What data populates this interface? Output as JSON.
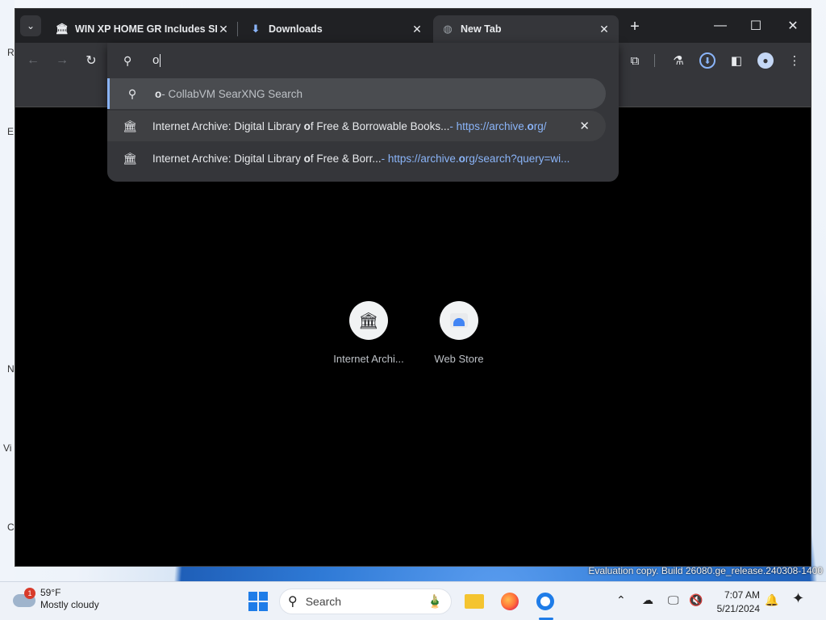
{
  "desktop": {
    "edge_letters": [
      "R",
      "E",
      "N",
      "Vi",
      "C"
    ]
  },
  "browser": {
    "tabs": [
      {
        "label": "WIN XP HOME GR Includes SP",
        "icon": "archive-icon"
      },
      {
        "label": "Downloads",
        "icon": "download-icon"
      },
      {
        "label": "New Tab",
        "icon": "globe-icon",
        "active": true
      }
    ],
    "omnibox": {
      "value": "o",
      "suggestions": [
        {
          "bold": "o",
          "text": " - CollabVM SearXNG Search",
          "icon": "search-icon"
        },
        {
          "title_pre": "Internet Archive: Digital Library ",
          "title_bold": "o",
          "title_post": "f Free & Borrowable Books...",
          "sep": " - ",
          "url_pre": "https://archive.",
          "url_bold": "o",
          "url_post": "rg/",
          "icon": "archive-icon"
        },
        {
          "title_pre": "Internet Archive: Digital Library ",
          "title_bold": "o",
          "title_post": "f Free & Borr...",
          "sep": " - ",
          "url_pre": "https://archive.",
          "url_bold": "o",
          "url_post": "rg/search?query=wi...",
          "icon": "archive-icon"
        }
      ]
    },
    "shortcuts": [
      {
        "label": "Internet Archi...",
        "icon": "archive-icon"
      },
      {
        "label": "Web Store",
        "icon": "webstore-icon"
      }
    ]
  },
  "watermark": "Evaluation copy. Build 26080.ge_release.240308-1400",
  "taskbar": {
    "weather": {
      "temp": "59°F",
      "condition": "Mostly cloudy",
      "badge": "1"
    },
    "search_placeholder": "Search",
    "clock": {
      "time": "7:07 AM",
      "date": "5/21/2024"
    }
  },
  "colors": {
    "accent": "#8ab4f8",
    "tab_active": "#35363a",
    "taskbar": "#eef2f8"
  }
}
